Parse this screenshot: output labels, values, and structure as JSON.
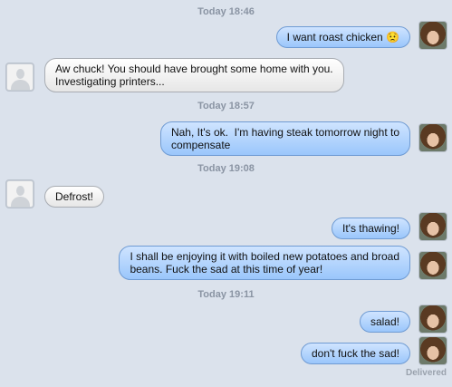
{
  "conversation": {
    "timestamps": [
      "Today 18:46",
      "Today 18:57",
      "Today 19:08",
      "Today 19:11"
    ],
    "messages": [
      {
        "text": "I want roast chicken 😟",
        "from": "me"
      },
      {
        "text": "Aw chuck! You should have brought some home with you.\nInvestigating printers...",
        "from": "them"
      },
      {
        "text": "Nah, It's ok.  I'm having steak tomorrow night to\ncompensate",
        "from": "me"
      },
      {
        "text": "Defrost!",
        "from": "them"
      },
      {
        "text": "It's thawing!",
        "from": "me"
      },
      {
        "text": "I shall be enjoying it with boiled new potatoes and broad\nbeans. Fuck the sad at this time of year!",
        "from": "me"
      },
      {
        "text": "salad!",
        "from": "me"
      },
      {
        "text": "don't fuck the sad!",
        "from": "me"
      }
    ],
    "status": "Delivered"
  },
  "colors": {
    "background": "#dbe2ec",
    "outgoing_bubble": "#9ac6fb",
    "incoming_bubble": "#ffffff"
  }
}
